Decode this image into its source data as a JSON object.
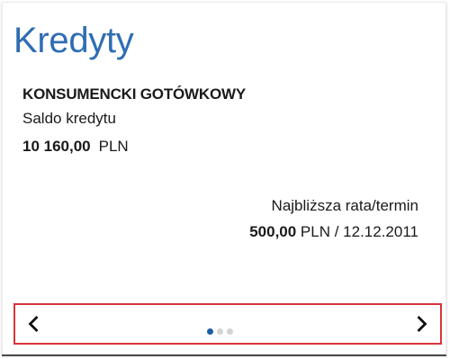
{
  "card": {
    "title": "Kredyty",
    "product_name": "KONSUMENCKI GOTÓWKOWY",
    "balance_label": "Saldo kredytu",
    "balance_amount": "10 160,00",
    "balance_currency": "PLN",
    "next_installment_label": "Najbliższa rata/termin",
    "next_installment_amount": "500,00",
    "next_installment_rest": " PLN / 12.12.2011"
  },
  "carousel": {
    "prev_icon": "chevron-left-icon",
    "next_icon": "chevron-right-icon",
    "page_count": 3,
    "active_index": 0
  },
  "colors": {
    "title": "#2f6db3",
    "highlight_border": "#d9343a",
    "active_dot": "#1d5ea6",
    "inactive_dot": "#d4d4d4"
  }
}
